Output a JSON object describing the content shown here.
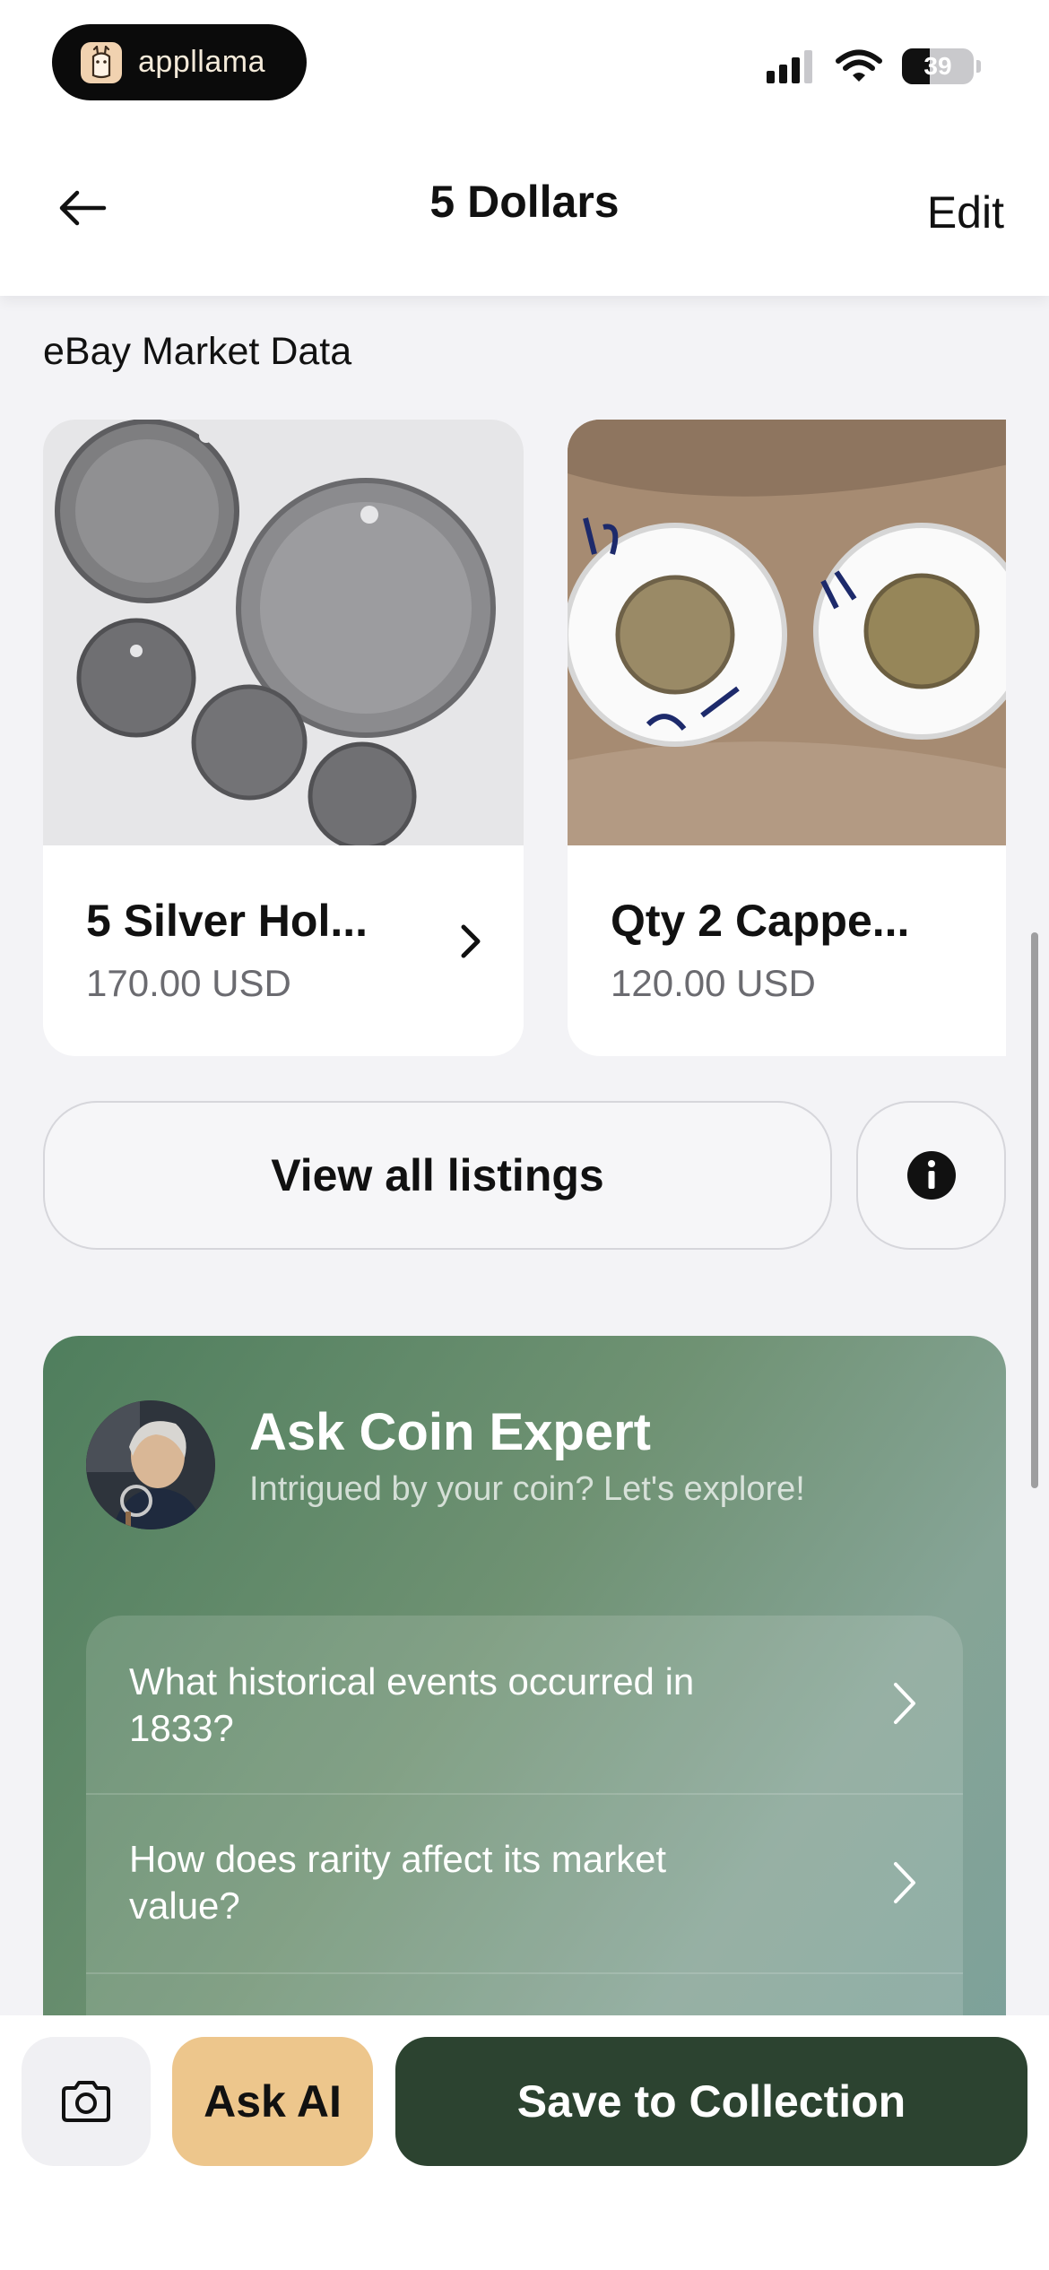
{
  "status_bar": {
    "brand": "appllama",
    "battery_level": "39",
    "battery_fraction": 0.39,
    "signal_bars_on": 3
  },
  "nav": {
    "title": "5 Dollars",
    "edit_label": "Edit",
    "back_icon": "arrow-left-icon"
  },
  "market": {
    "section_title": "eBay Market Data",
    "listings": [
      {
        "title": "5 Silver Hol...",
        "price": "170.00 USD"
      },
      {
        "title": "Qty 2 Cappe...",
        "price": "120.00 USD"
      }
    ],
    "view_all_label": "View all listings",
    "info_icon": "info-icon"
  },
  "expert": {
    "title": "Ask Coin Expert",
    "subtitle": "Intrigued by your coin? Let's explore!",
    "questions": [
      {
        "text": "What historical events occurred in 1833?"
      },
      {
        "text": "How does rarity affect its market value?"
      }
    ]
  },
  "bottom_bar": {
    "camera_icon": "camera-icon",
    "ask_label": "Ask AI",
    "save_label": "Save to Collection"
  },
  "colors": {
    "save_button": "#2c4330",
    "ask_button": "#edc68c",
    "expert_gradient_start": "#4f7e5d",
    "expert_gradient_end": "#7da19a"
  }
}
